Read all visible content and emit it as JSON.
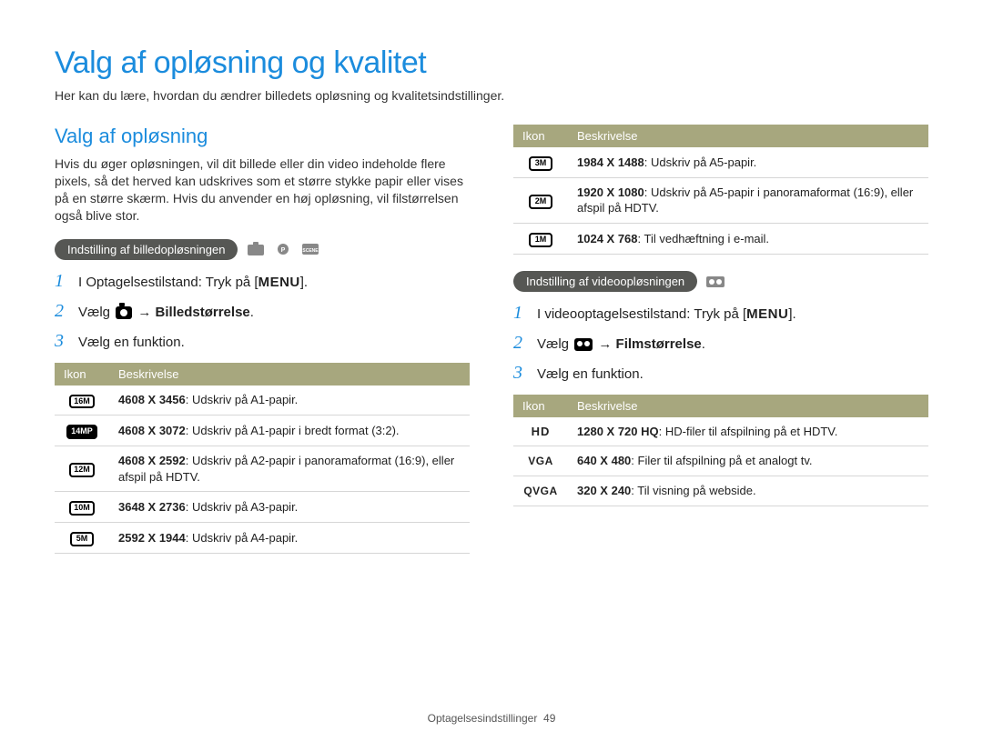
{
  "page_title": "Valg af opløsning og kvalitet",
  "intro": "Her kan du lære, hvordan du ændrer billedets opløsning og kvalitetsindstillinger.",
  "section_title": "Valg af opløsning",
  "section_body": "Hvis du øger opløsningen, vil dit billede eller din video indeholde flere pixels, så det herved kan udskrives som et større stykke papir eller vises på en større skærm. Hvis du anvender en høj opløsning, vil filstørrelsen også blive stor.",
  "photo_pill": "Indstilling af billedopløsningen",
  "video_pill": "Indstilling af videoopløsningen",
  "table_header_icon": "Ikon",
  "table_header_desc": "Beskrivelse",
  "step_verb": "Vælg",
  "arrow": "→",
  "photo_steps": {
    "s1_pre": "I Optagelsestilstand: Tryk på [",
    "s1_menu": "MENU",
    "s1_post": "].",
    "s2_target": "Billedstørrelse",
    "s3": "Vælg en funktion."
  },
  "video_steps": {
    "s1_pre": "I videooptagelsestilstand: Tryk på [",
    "s1_menu": "MENU",
    "s1_post": "].",
    "s2_target": "Filmstørrelse",
    "s3": "Vælg en funktion."
  },
  "photo_table": [
    {
      "icon": "16M",
      "res": "4608 X 3456",
      "desc": ": Udskriv på A1-papir."
    },
    {
      "icon": "14MP",
      "res": "4608 X 3072",
      "desc": ": Udskriv på A1-papir i bredt format (3:2)."
    },
    {
      "icon": "12M",
      "res": "4608 X 2592",
      "desc": ": Udskriv på A2-papir i panoramaformat (16:9), eller afspil på HDTV."
    },
    {
      "icon": "10M",
      "res": "3648 X 2736",
      "desc": ": Udskriv på A3-papir."
    },
    {
      "icon": "5M",
      "res": "2592 X 1944",
      "desc": ": Udskriv på A4-papir."
    }
  ],
  "photo_table_cont": [
    {
      "icon": "3M",
      "res": "1984 X 1488",
      "desc": ": Udskriv på A5-papir."
    },
    {
      "icon": "2M",
      "res": "1920 X 1080",
      "desc": ": Udskriv på A5-papir i panoramaformat (16:9), eller afspil på HDTV."
    },
    {
      "icon": "1M",
      "res": "1024 X 768",
      "desc": ": Til vedhæftning i e-mail."
    }
  ],
  "video_table": [
    {
      "icon": "HD",
      "res": "1280 X 720 HQ",
      "desc": ": HD-filer til afspilning på et HDTV."
    },
    {
      "icon": "VGA",
      "res": "640 X 480",
      "desc": ": Filer til afspilning på et analogt tv."
    },
    {
      "icon": "QVGA",
      "res": "320 X 240",
      "desc": ": Til visning på webside."
    }
  ],
  "footer_section": "Optagelsesindstillinger",
  "footer_page": "49"
}
